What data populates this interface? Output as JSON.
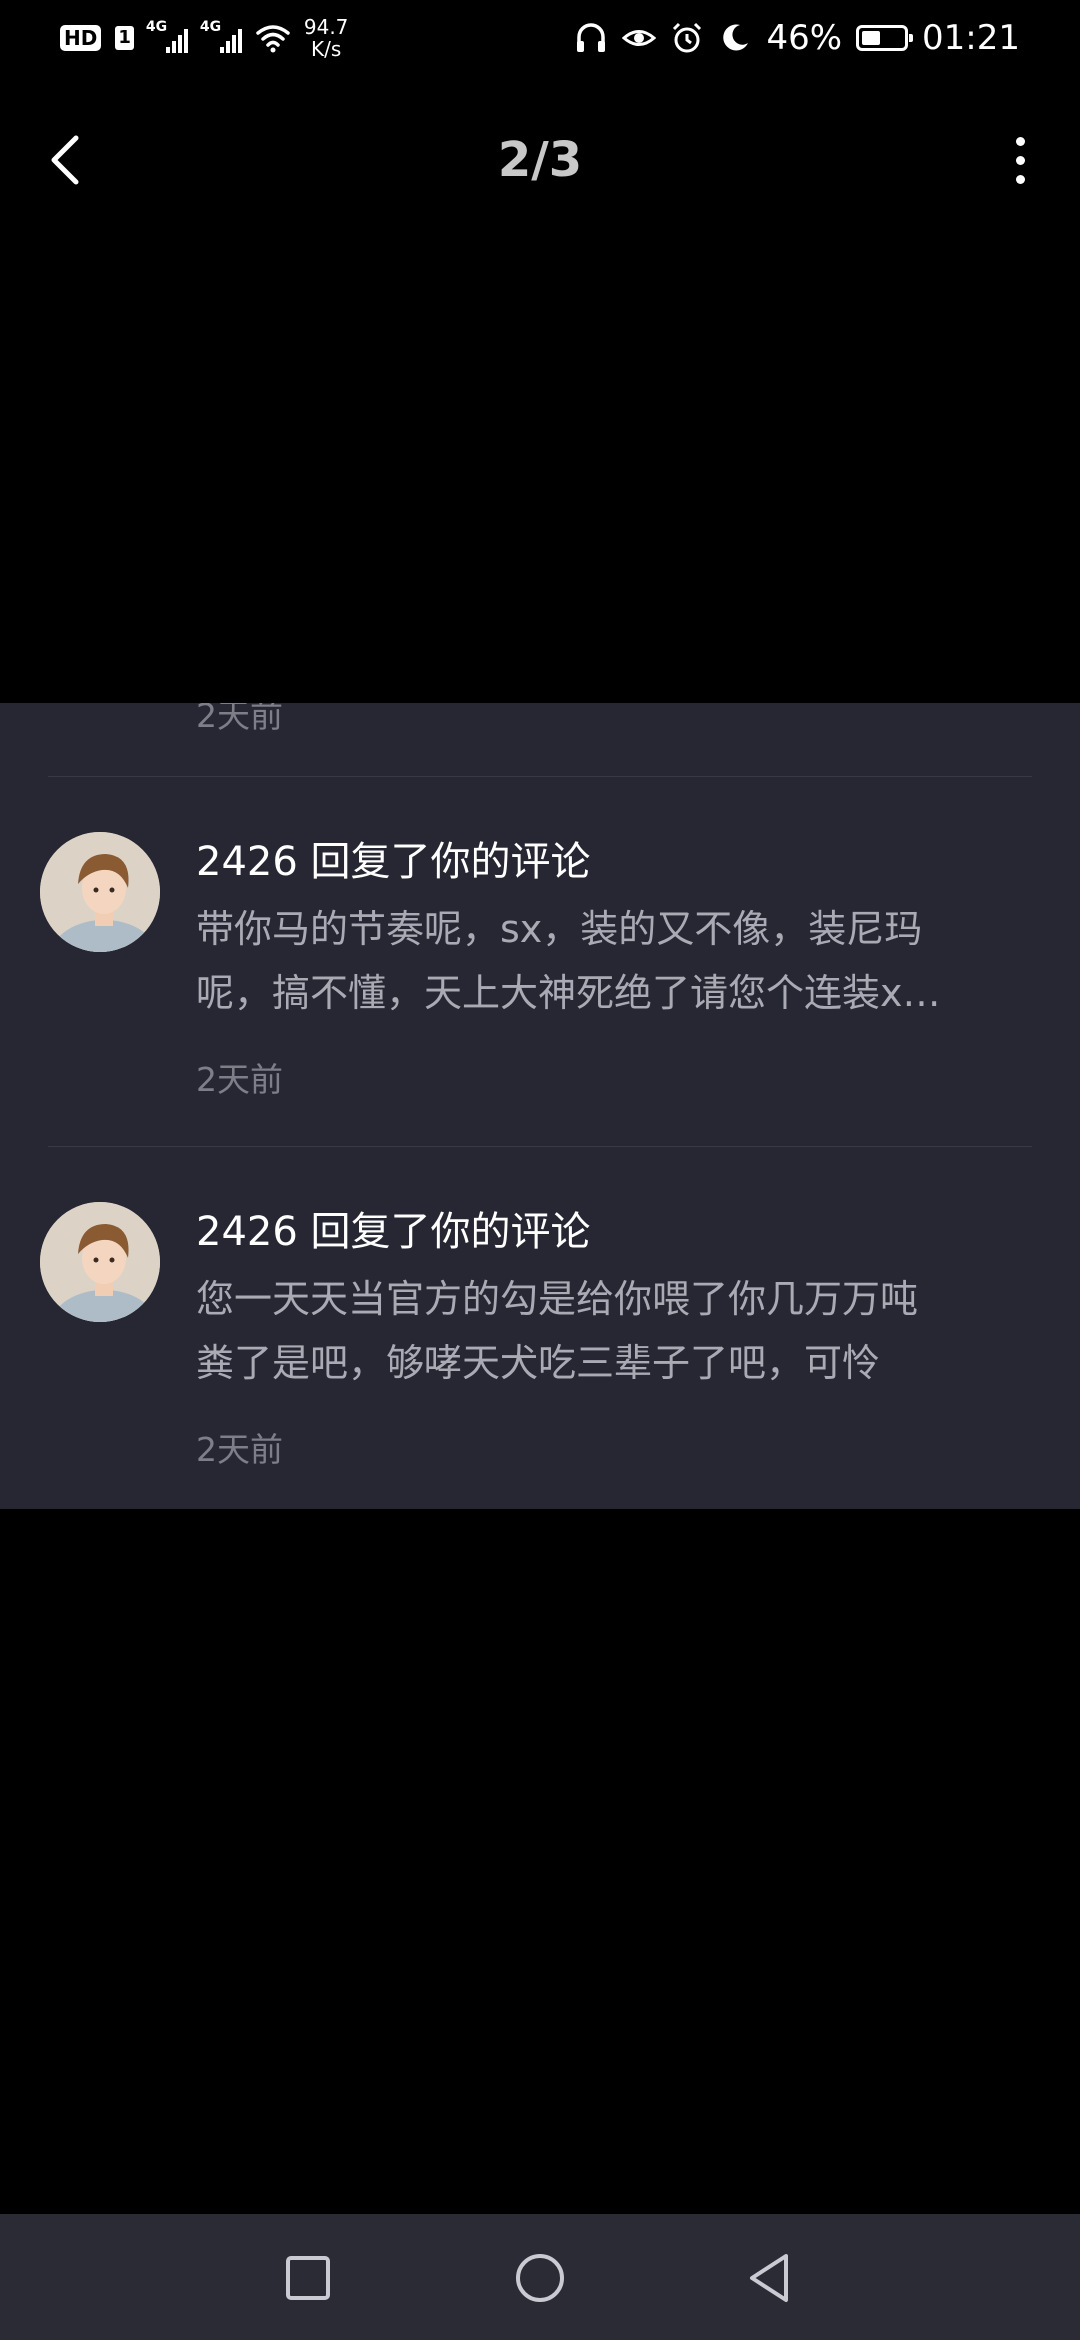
{
  "status_bar": {
    "hd": "HD",
    "sim1": "1",
    "network1": "4G",
    "network2": "4G",
    "speed_value": "94.7",
    "speed_unit": "K/s",
    "battery_percent": "46%",
    "battery_level": 0.46,
    "time": "01:21"
  },
  "header": {
    "page_indicator": "2/3",
    "back_icon": "chevron-left-icon",
    "more_icon": "more-vertical-icon"
  },
  "notifications": {
    "partial_time": "2天前",
    "items": [
      {
        "title": "2426 回复了你的评论",
        "body_lines": [
          "带你马的节奏呢，sx，装的又不像，装尼玛",
          "呢，搞不懂，天上大神死绝了请您个连装x…"
        ],
        "time": "2天前"
      },
      {
        "title": "2426 回复了你的评论",
        "body_lines": [
          "您一天天当官方的勾是给你喂了你几万万吨",
          "粪了是吧，够哮天犬吃三辈子了吧，可怜"
        ],
        "time": "2天前"
      }
    ]
  },
  "nav_bar": {
    "recents_icon": "square-icon",
    "home_icon": "circle-icon",
    "back_icon": "triangle-back-icon"
  },
  "colors": {
    "background": "#000000",
    "card": "#262733",
    "title_text": "#ffffff",
    "body_text": "#a9aab3",
    "time_text": "#7d7e88",
    "nav_bar": "#2a2b35"
  }
}
